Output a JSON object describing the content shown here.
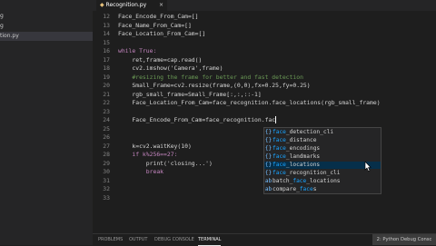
{
  "sidebar": {
    "items": [
      {
        "label": "g",
        "selected": false
      },
      {
        "label": "g",
        "selected": false
      },
      {
        "label": "tion.py",
        "selected": true
      }
    ]
  },
  "tab": {
    "label": "Recognition.py",
    "close": "×"
  },
  "breadcrumbs": "",
  "editor": {
    "lines": [
      {
        "no": "12",
        "text": "Face_Encode_From_Cam=[]"
      },
      {
        "no": "13",
        "text": "Face_Name_From_Cam=[]"
      },
      {
        "no": "14",
        "text": "Face_Location_From_Cam=[]"
      },
      {
        "no": "15",
        "text": ""
      },
      {
        "no": "16",
        "text": "while True:"
      },
      {
        "no": "17",
        "text": "    ret,frame=cap.read()"
      },
      {
        "no": "18",
        "text": "    cv2.imshow('Camera',frame)"
      },
      {
        "no": "19",
        "text": "    #resizing the frame for better and fast detection"
      },
      {
        "no": "20",
        "text": "    Small_Frame=cv2.resize(frame,(0,0),fx=0.25,fy=0.25)"
      },
      {
        "no": "21",
        "text": "    rgb_small_frame=Small_Frame[:,:,::-1]"
      },
      {
        "no": "22",
        "text": "    Face_Location_From_Cam=face_recognition.face_locations(rgb_small_frame)"
      },
      {
        "no": "23",
        "text": ""
      },
      {
        "no": "24",
        "text": "    Face_Encode_From_Cam=face_recognition.fac"
      },
      {
        "no": "25",
        "text": ""
      },
      {
        "no": "26",
        "text": ""
      },
      {
        "no": "27",
        "text": "    k=cv2.waitKey(10)"
      },
      {
        "no": "28",
        "text": "    if k%256==27:"
      },
      {
        "no": "29",
        "text": "        print('closing...')"
      },
      {
        "no": "30",
        "text": "        break"
      },
      {
        "no": "31",
        "text": ""
      },
      {
        "no": "32",
        "text": ""
      },
      {
        "no": "33",
        "text": ""
      }
    ]
  },
  "suggestions": {
    "typed": "fac",
    "items": [
      {
        "icon": "{}",
        "prefix": "",
        "match": "face",
        "rest": "_detection_cli",
        "selected": false
      },
      {
        "icon": "{}",
        "prefix": "",
        "match": "face",
        "rest": "_distance",
        "selected": false
      },
      {
        "icon": "{}",
        "prefix": "",
        "match": "face",
        "rest": "_encodings",
        "selected": false
      },
      {
        "icon": "{}",
        "prefix": "",
        "match": "face",
        "rest": "_landmarks",
        "selected": false
      },
      {
        "icon": "{}",
        "prefix": "",
        "match": "face",
        "rest": "_locations",
        "selected": true
      },
      {
        "icon": "{}",
        "prefix": "",
        "match": "face",
        "rest": "_recognition_cli",
        "selected": false
      },
      {
        "icon": "ab",
        "prefix": "batch_",
        "match": "face",
        "rest": "_locations",
        "selected": false
      },
      {
        "icon": "ab",
        "prefix": "compare_",
        "match": "face",
        "rest": "s",
        "selected": false
      }
    ]
  },
  "panel": {
    "tabs": [
      {
        "label": "PROBLEMS",
        "active": false
      },
      {
        "label": "OUTPUT",
        "active": false
      },
      {
        "label": "DEBUG CONSOLE",
        "active": false
      },
      {
        "label": "TERMINAL",
        "active": true
      }
    ],
    "terminal_select": "2: Python Debug Consc"
  },
  "colors": {
    "editor_bg": "#1e1e1e",
    "sidebar_bg": "#252526",
    "selection": "#062f4a",
    "match_highlight": "#18a3ff"
  }
}
